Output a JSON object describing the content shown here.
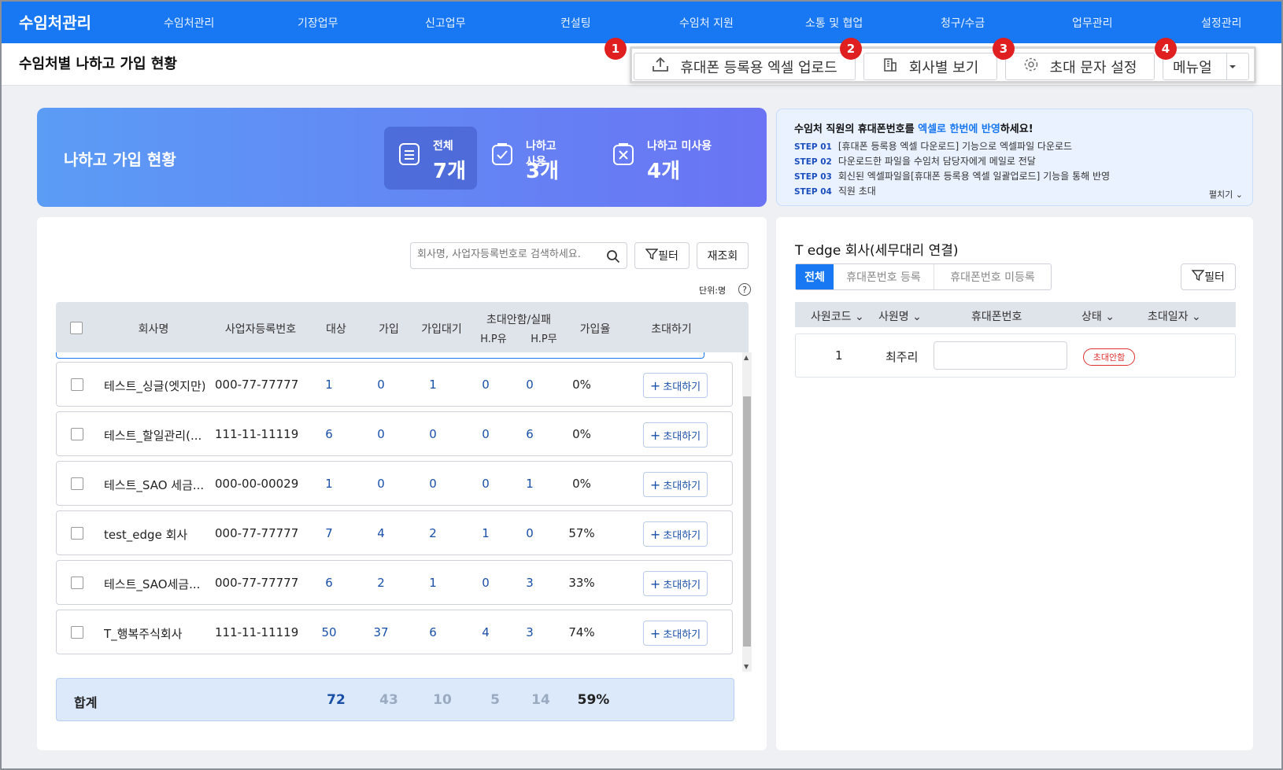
{
  "app": {
    "brand": "수임처관리",
    "nav": [
      "수임처관리",
      "기장업무",
      "신고업무",
      "컨설팅",
      "수임처 지원",
      "소통 및 협업",
      "청구/수금",
      "업무관리",
      "설정관리"
    ]
  },
  "page": {
    "title": "수임처별 나하고 가입 현황",
    "actions": {
      "upload_label": "휴대폰 등록용 엑셀 업로드",
      "company_view_label": "회사별 보기",
      "invite_msg_label": "초대 문자 설정",
      "manual_label": "메뉴얼"
    },
    "badges": [
      "1",
      "2",
      "3",
      "4"
    ]
  },
  "summary": {
    "title": "나하고 가입 현황",
    "stats": [
      {
        "label": "전체",
        "value": "7개",
        "icon": "list-icon"
      },
      {
        "label": "나하고 사용",
        "value": "3개",
        "icon": "check-icon"
      },
      {
        "label": "나하고 미사용",
        "value": "4개",
        "icon": "x-icon"
      }
    ]
  },
  "info": {
    "head_pre": "수임처 직원의 휴대폰번호를 ",
    "head_hl": "엑셀로 한번에 반영",
    "head_post": "하세요!",
    "steps": [
      {
        "tag": "STEP 01",
        "text": "[휴대폰 등록용 엑셀 다운로드] 기능으로 엑셀파일 다운로드"
      },
      {
        "tag": "STEP 02",
        "text": "다운로드한 파일을 수임처 담당자에게 메일로 전달"
      },
      {
        "tag": "STEP 03",
        "text": "회신된 엑셀파일을[휴대폰 등록용 엑셀 일괄업로드] 기능을 통해 반영"
      },
      {
        "tag": "STEP 04",
        "text": "직원 초대"
      }
    ],
    "fold_label": "펼치기"
  },
  "list": {
    "search_placeholder": "회사명, 사업자등록번호로 검색하세요.",
    "filter_label": "필터",
    "refresh_label": "재조회",
    "unit_label": "단위:명",
    "headers": {
      "company": "회사명",
      "bizno": "사업자등록번호",
      "target": "대상",
      "joined": "가입",
      "pending": "가입대기",
      "invite_fail": "초대안함/실패",
      "hp_yes": "H.P유",
      "hp_no": "H.P무",
      "rate": "가입율",
      "invite": "초대하기"
    },
    "rows": [
      {
        "company": "테스트_싱글(엣지만)",
        "bizno": "000-77-77777",
        "target": "1",
        "joined": "0",
        "pending": "1",
        "hp_yes": "0",
        "hp_no": "0",
        "rate": "0%"
      },
      {
        "company": "테스트_할일관리(...",
        "bizno": "111-11-11119",
        "target": "6",
        "joined": "0",
        "pending": "0",
        "hp_yes": "0",
        "hp_no": "6",
        "rate": "0%"
      },
      {
        "company": "테스트_SAO 세금...",
        "bizno": "000-00-00029",
        "target": "1",
        "joined": "0",
        "pending": "0",
        "hp_yes": "0",
        "hp_no": "1",
        "rate": "0%"
      },
      {
        "company": "test_edge 회사",
        "bizno": "000-77-77777",
        "target": "7",
        "joined": "4",
        "pending": "2",
        "hp_yes": "1",
        "hp_no": "0",
        "rate": "57%"
      },
      {
        "company": "테스트_SAO세금...",
        "bizno": "000-77-77777",
        "target": "6",
        "joined": "2",
        "pending": "1",
        "hp_yes": "0",
        "hp_no": "3",
        "rate": "33%"
      },
      {
        "company": "T_행복주식회사",
        "bizno": "111-11-11119",
        "target": "50",
        "joined": "37",
        "pending": "6",
        "hp_yes": "4",
        "hp_no": "3",
        "rate": "74%"
      }
    ],
    "invite_btn_label": "초대하기",
    "total": {
      "label": "합계",
      "target": "72",
      "joined": "43",
      "pending": "10",
      "hp_yes": "5",
      "hp_no": "14",
      "rate": "59%"
    }
  },
  "detail": {
    "title": "T edge 회사(세무대리 연결)",
    "tabs": [
      "전체",
      "휴대폰번호 등록",
      "휴대폰번호 미등록"
    ],
    "filter_label": "필터",
    "headers": [
      "사원코드",
      "사원명",
      "휴대폰번호",
      "상태",
      "초대일자"
    ],
    "rows": [
      {
        "code": "1",
        "name": "최주리",
        "phone": "",
        "status": "초대안함"
      }
    ]
  },
  "colors": {
    "primary": "#1877f2",
    "badge": "#e02020",
    "status_red": "#e03030"
  }
}
